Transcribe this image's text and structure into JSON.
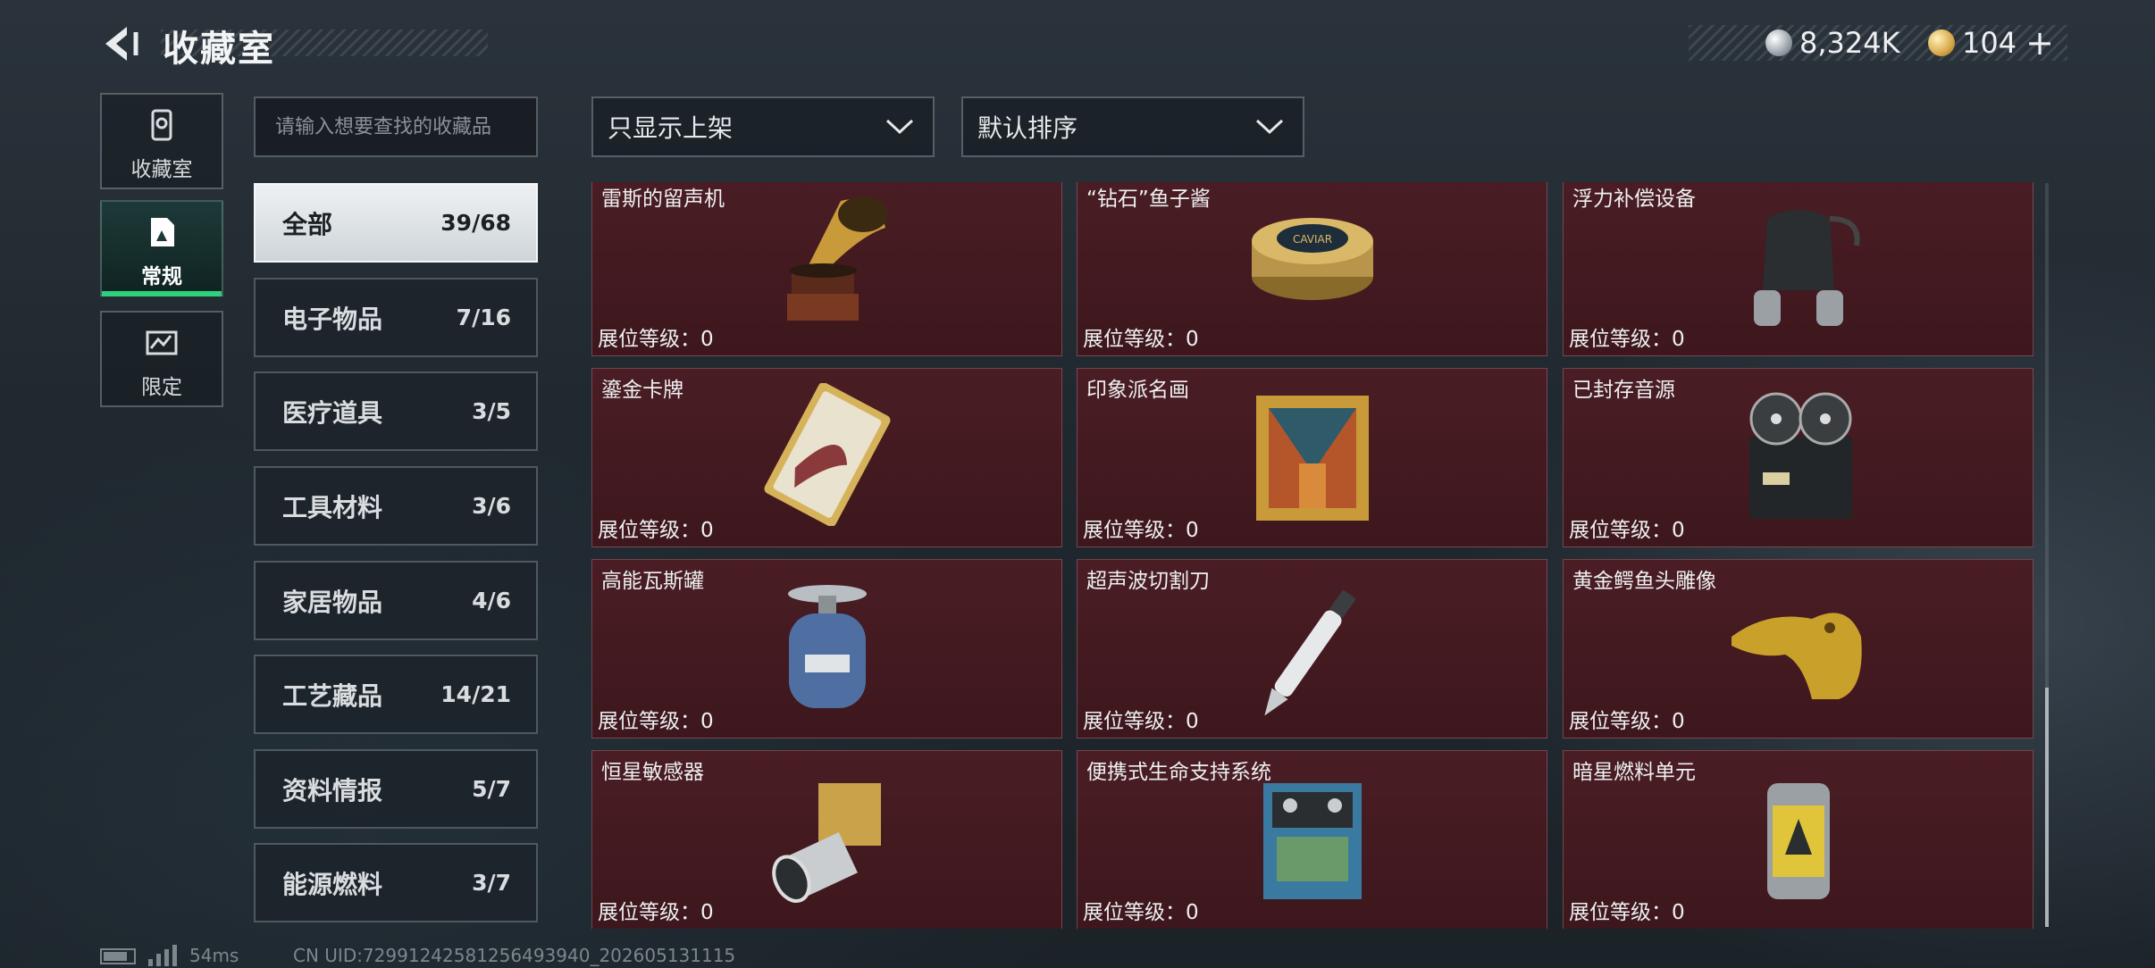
{
  "header": {
    "title": "收藏室",
    "currency": [
      {
        "icon": "silver-coin-icon",
        "amount": "8,324K"
      },
      {
        "icon": "gold-coin-icon",
        "amount": "104"
      }
    ]
  },
  "sidebar": {
    "items": [
      {
        "label": "收藏室",
        "icon": "collection-room-icon",
        "active": false
      },
      {
        "label": "常规",
        "icon": "regular-icon",
        "active": true
      },
      {
        "label": "限定",
        "icon": "limited-icon",
        "active": false
      }
    ]
  },
  "search": {
    "placeholder": "请输入想要查找的收藏品",
    "value": ""
  },
  "categories": [
    {
      "name": "全部",
      "count": "39/68",
      "active": true
    },
    {
      "name": "电子物品",
      "count": "7/16"
    },
    {
      "name": "医疗道具",
      "count": "3/5"
    },
    {
      "name": "工具材料",
      "count": "3/6"
    },
    {
      "name": "家居物品",
      "count": "4/6"
    },
    {
      "name": "工艺藏品",
      "count": "14/21"
    },
    {
      "name": "资料情报",
      "count": "5/7"
    },
    {
      "name": "能源燃料",
      "count": "3/7"
    }
  ],
  "filters": {
    "listing": "只显示上架",
    "sort": "默认排序"
  },
  "items": [
    {
      "name": "雷斯的留声机",
      "level": "展位等级：0",
      "icon": "gramophone-icon"
    },
    {
      "name": "“钻石”鱼子酱",
      "level": "展位等级：0",
      "icon": "caviar-tin-icon"
    },
    {
      "name": "浮力补偿设备",
      "level": "展位等级：0",
      "icon": "buoyancy-device-icon"
    },
    {
      "name": "鎏金卡牌",
      "level": "展位等级：0",
      "icon": "gilded-card-icon"
    },
    {
      "name": "印象派名画",
      "level": "展位等级：0",
      "icon": "framed-painting-icon"
    },
    {
      "name": "已封存音源",
      "level": "展位等级：0",
      "icon": "reel-tape-recorder-icon"
    },
    {
      "name": "高能瓦斯罐",
      "level": "展位等级：0",
      "icon": "gas-canister-icon"
    },
    {
      "name": "超声波切割刀",
      "level": "展位等级：0",
      "icon": "ultrasonic-cutter-icon"
    },
    {
      "name": "黄金鳄鱼头雕像",
      "level": "展位等级：0",
      "icon": "golden-crocodile-icon"
    },
    {
      "name": "恒星敏感器",
      "level": "展位等级：0",
      "icon": "star-sensor-icon"
    },
    {
      "name": "便携式生命支持系统",
      "level": "展位等级：0",
      "icon": "life-support-icon"
    },
    {
      "name": "暗星燃料单元",
      "level": "展位等级：0",
      "icon": "fuel-cell-icon"
    }
  ],
  "footer": {
    "ping": "54ms",
    "uid": "CN UID:72991242581256493940_202605131115"
  }
}
